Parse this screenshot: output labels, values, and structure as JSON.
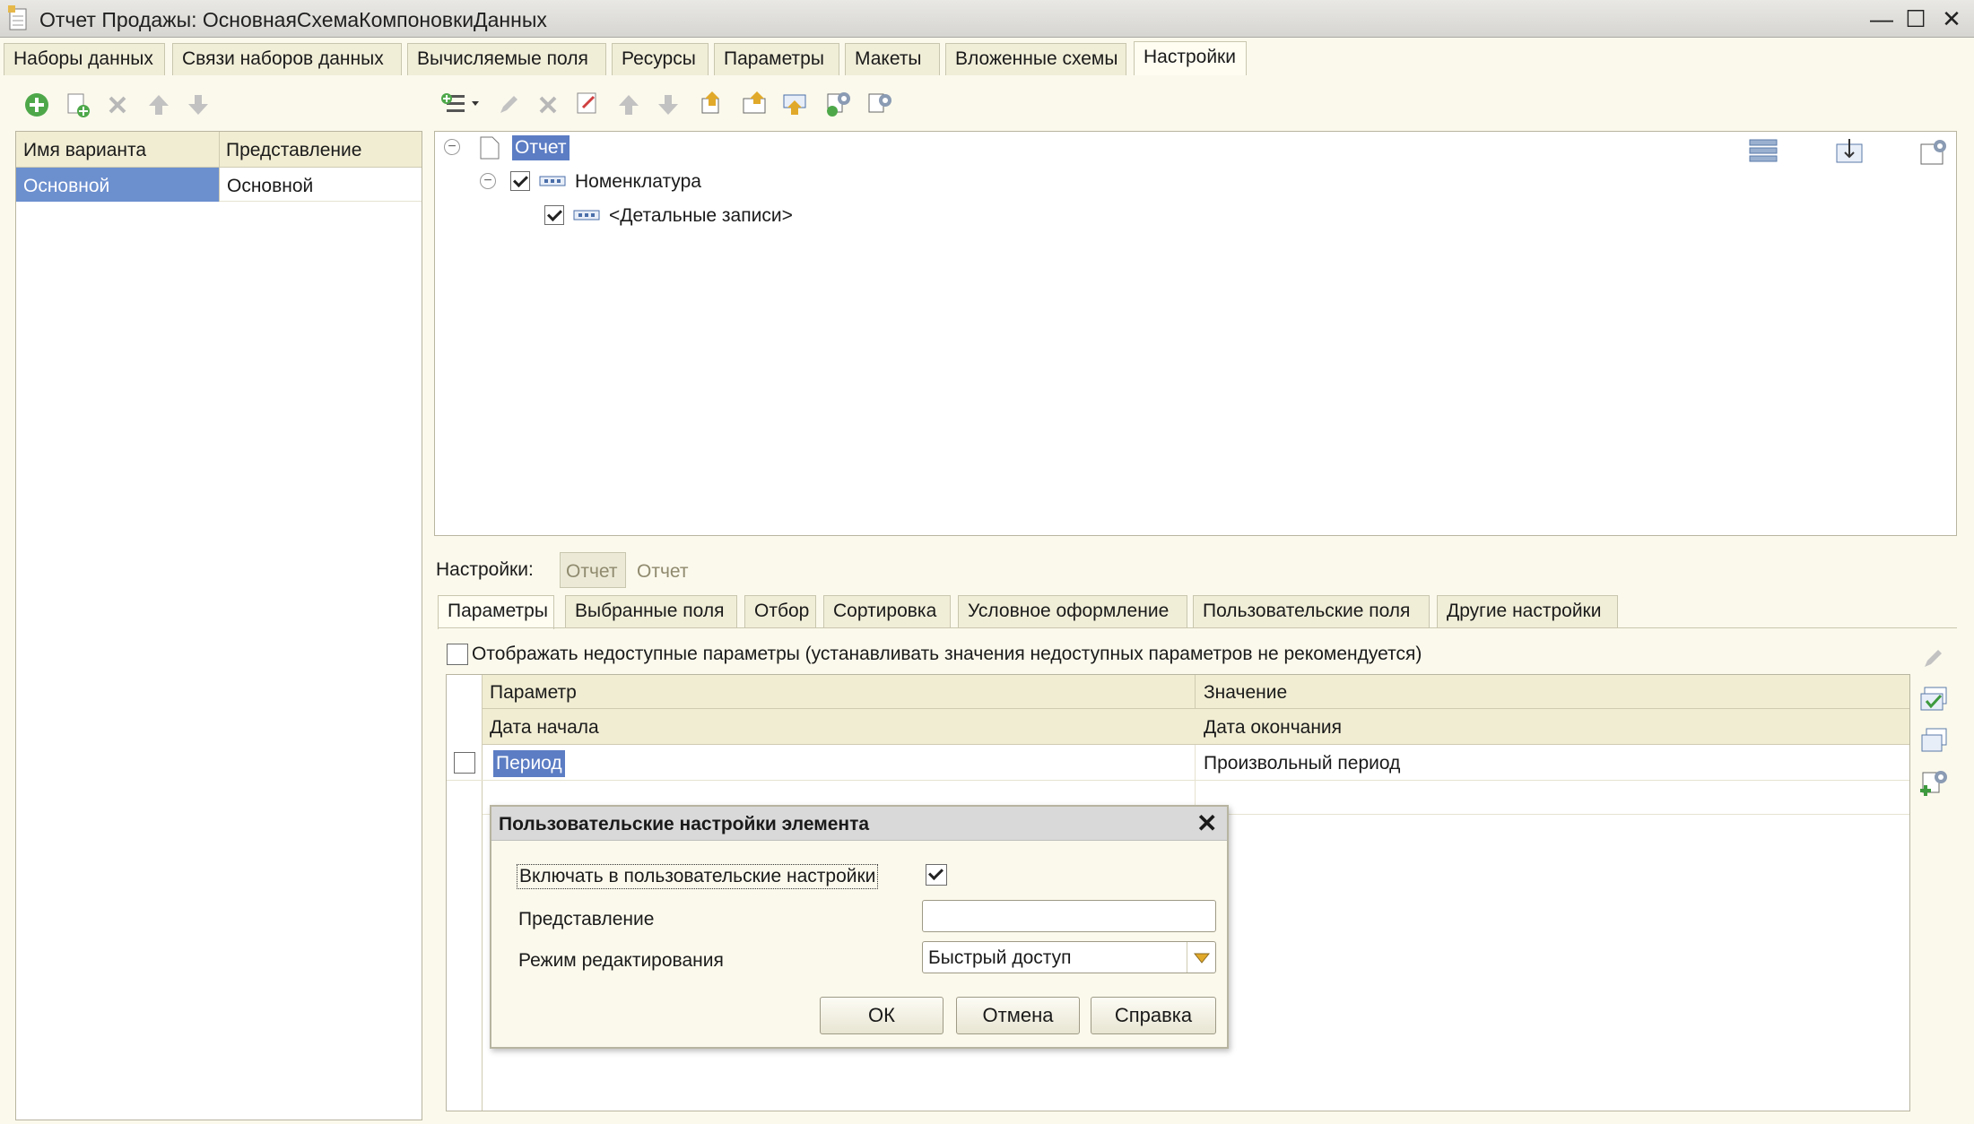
{
  "window": {
    "title": "Отчет Продажы: ОсновнаяСхемаКомпоновкиДанных"
  },
  "tabs": [
    "Наборы данных",
    "Связи наборов данных",
    "Вычисляемые поля",
    "Ресурсы",
    "Параметры",
    "Макеты",
    "Вложенные схемы",
    "Настройки"
  ],
  "variants": {
    "col_name": "Имя варианта",
    "col_repr": "Представление",
    "rows": [
      {
        "name": "Основной",
        "repr": "Основной"
      }
    ]
  },
  "tree": {
    "root": "Отчет",
    "child": "Номенклатура",
    "grandchild": "<Детальные записи>"
  },
  "settings": {
    "label": "Настройки:",
    "btn_active": "Отчет",
    "btn_other": "Отчет"
  },
  "settings_tabs": [
    "Параметры",
    "Выбранные поля",
    "Отбор",
    "Сортировка",
    "Условное оформление",
    "Пользовательские поля",
    "Другие настройки"
  ],
  "show_unavailable": "Отображать недоступные параметры (устанавливать значения недоступных параметров не рекомендуется)",
  "params": {
    "col_param": "Параметр",
    "col_value": "Значение",
    "sub_param": "Дата начала",
    "sub_value": "Дата окончания",
    "row": {
      "param": "Период",
      "value": "Произвольный период"
    }
  },
  "dialog": {
    "title": "Пользовательские настройки элемента",
    "include_label": "Включать в пользовательские настройки",
    "repr_label": "Представление",
    "repr_value": "",
    "mode_label": "Режим редактирования",
    "mode_value": "Быстрый доступ",
    "ok": "ОК",
    "cancel": "Отмена",
    "help": "Справка"
  }
}
